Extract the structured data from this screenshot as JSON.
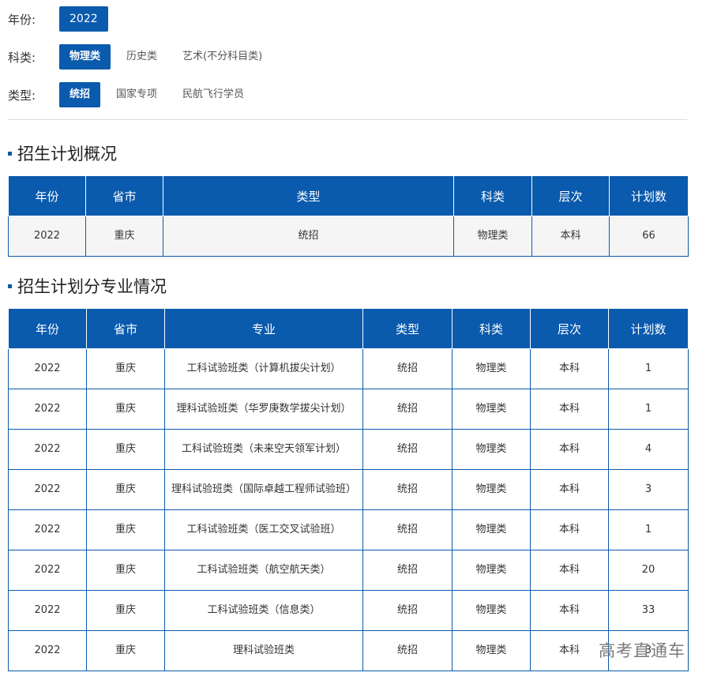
{
  "filters": {
    "year": {
      "label": "年份:",
      "options": [
        "2022"
      ]
    },
    "subject": {
      "label": "科类:",
      "options": [
        "物理类",
        "历史类",
        "艺术(不分科目类)"
      ]
    },
    "type": {
      "label": "类型:",
      "options": [
        "统招",
        "国家专项",
        "民航飞行学员"
      ]
    }
  },
  "overview": {
    "title": "招生计划概况",
    "headers": [
      "年份",
      "省市",
      "类型",
      "科类",
      "层次",
      "计划数"
    ],
    "rows": [
      [
        "2022",
        "重庆",
        "统招",
        "物理类",
        "本科",
        "66"
      ]
    ]
  },
  "majors": {
    "title": "招生计划分专业情况",
    "headers": [
      "年份",
      "省市",
      "专业",
      "类型",
      "科类",
      "层次",
      "计划数"
    ],
    "rows": [
      [
        "2022",
        "重庆",
        "工科试验班类（计算机拔尖计划）",
        "统招",
        "物理类",
        "本科",
        "1"
      ],
      [
        "2022",
        "重庆",
        "理科试验班类（华罗庚数学拔尖计划）",
        "统招",
        "物理类",
        "本科",
        "1"
      ],
      [
        "2022",
        "重庆",
        "工科试验班类（未来空天领军计划）",
        "统招",
        "物理类",
        "本科",
        "4"
      ],
      [
        "2022",
        "重庆",
        "理科试验班类（国际卓越工程师试验班）",
        "统招",
        "物理类",
        "本科",
        "3"
      ],
      [
        "2022",
        "重庆",
        "工科试验班类（医工交叉试验班）",
        "统招",
        "物理类",
        "本科",
        "1"
      ],
      [
        "2022",
        "重庆",
        "工科试验班类（航空航天类）",
        "统招",
        "物理类",
        "本科",
        "20"
      ],
      [
        "2022",
        "重庆",
        "工科试验班类（信息类）",
        "统招",
        "物理类",
        "本科",
        "33"
      ],
      [
        "2022",
        "重庆",
        "理科试验班类",
        "统招",
        "物理类",
        "本科",
        "3"
      ]
    ]
  },
  "watermark": "高考直通车"
}
